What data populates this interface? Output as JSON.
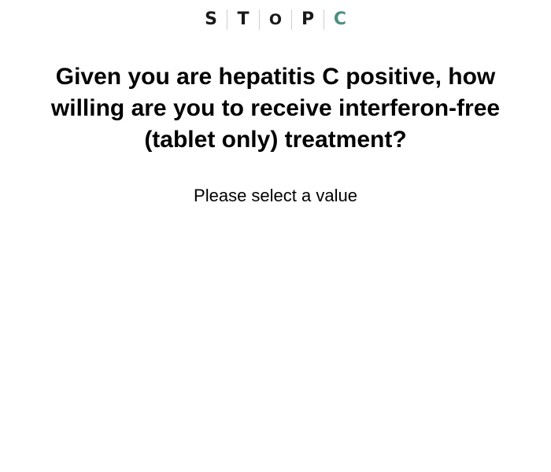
{
  "logo": {
    "letters": [
      "S",
      "T",
      "O",
      "P",
      "C"
    ],
    "accent_color": "#4e8f7f",
    "text_color": "#1a1a1a"
  },
  "question": {
    "text": "Given you are hepatitis C positive, how willing are you to receive interferon-free (tablet only) treatment?"
  },
  "prompt": {
    "text": "Please select a value"
  }
}
